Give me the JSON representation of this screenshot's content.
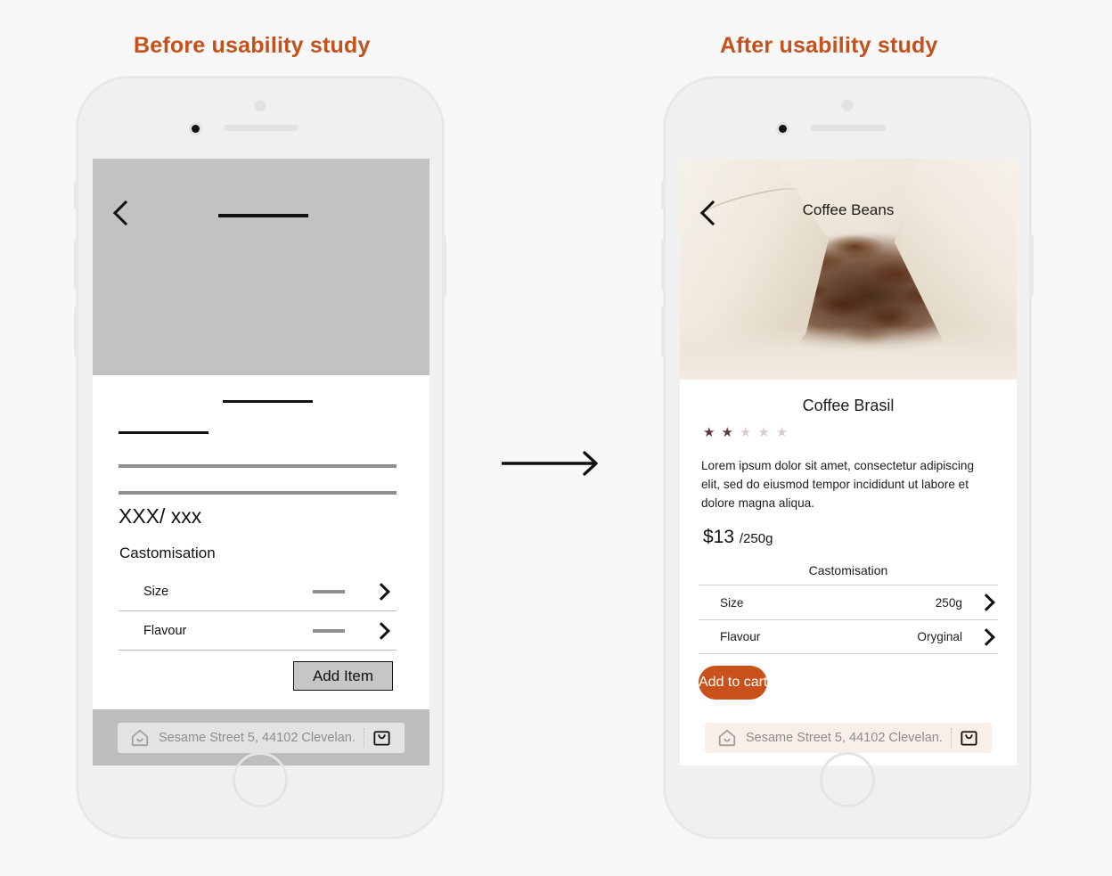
{
  "panels": {
    "before_title": "Before usability study",
    "after_title": "After usability study"
  },
  "colors": {
    "accent": "#c4511a",
    "cart_button": "#c8521a",
    "wireframe_grey": "#c2c2c2",
    "star_on": "#5c3a3a",
    "star_off": "#d8cccc",
    "page_background": "#f7f7f8"
  },
  "before": {
    "hero": {
      "back_icon": "chevron-left-icon",
      "title_placeholder": "placeholder-bar"
    },
    "body": {
      "price_placeholder": "XXX/ xxx",
      "customisation_label": "Castomisation",
      "rows": [
        {
          "label": "Size",
          "value": "",
          "chevron": "chevron-right-icon"
        },
        {
          "label": "Flavour",
          "value": "",
          "chevron": "chevron-right-icon"
        }
      ],
      "add_button_label": "Add Item"
    },
    "bottom_bar": {
      "home_icon": "home-icon",
      "address": "Sesame Street 5, 44102 Clevelan...",
      "cart_icon": "shopping-bag-icon"
    }
  },
  "after": {
    "hero": {
      "back_icon": "chevron-left-icon",
      "title": "Coffee Beans",
      "photo_alt": "coffee-beans-in-canvas-sack"
    },
    "body": {
      "product_name": "Coffee Brasil",
      "rating": {
        "filled": 2,
        "total": 5
      },
      "description": "Lorem ipsum dolor sit amet, consectetur adipiscing elit, sed do eiusmod tempor incididunt ut labore et dolore magna aliqua.",
      "price": "$13",
      "price_unit": "/250g",
      "customisation_label": "Castomisation",
      "rows": [
        {
          "label": "Size",
          "value": "250g",
          "chevron": "chevron-right-icon"
        },
        {
          "label": "Flavour",
          "value": "Oryginal",
          "chevron": "chevron-right-icon"
        }
      ],
      "add_button_label": "Add to cart"
    },
    "bottom_bar": {
      "home_icon": "home-icon",
      "address": "Sesame Street 5, 44102 Clevelan...",
      "cart_icon": "shopping-bag-icon"
    }
  },
  "flow": {
    "arrow": "arrow-right-icon"
  }
}
